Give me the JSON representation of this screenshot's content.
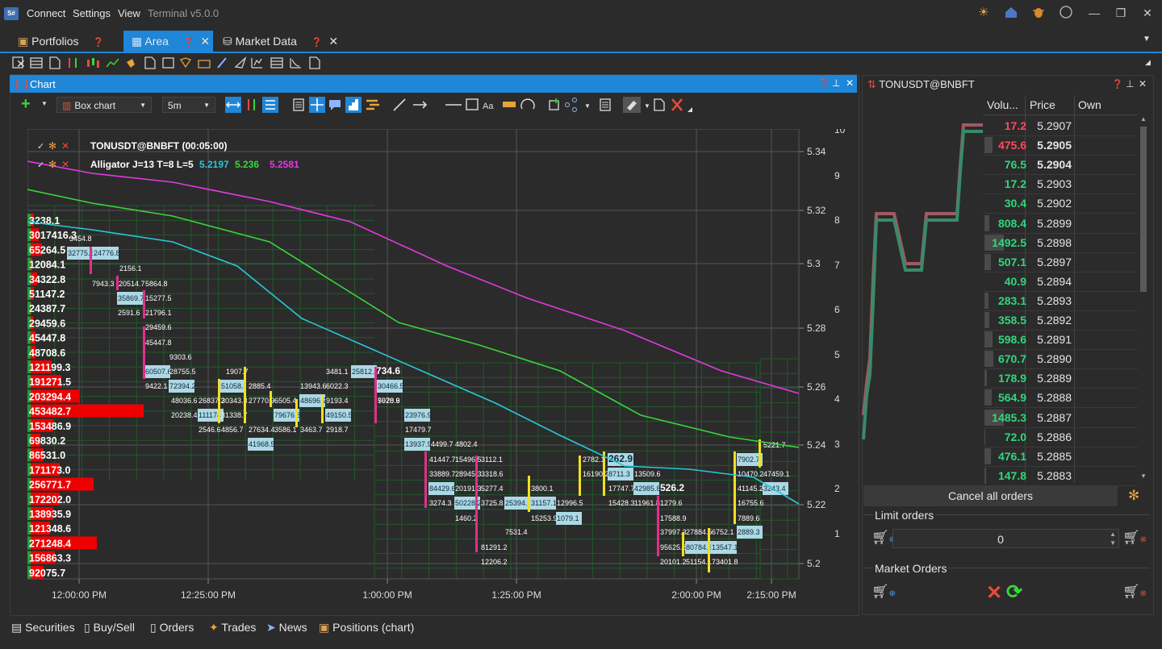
{
  "app": {
    "logo": "S#",
    "menu": [
      "Connect",
      "Settings",
      "View"
    ],
    "title": "Terminal v5.0.0",
    "title_icons": [
      "sun-icon",
      "home-icon",
      "bug-icon",
      "chat-icon"
    ],
    "accent": "#1f86d8"
  },
  "tabs": [
    {
      "label": "Portfolios",
      "active": false
    },
    {
      "label": "Area",
      "active": true
    },
    {
      "label": "Market Data",
      "active": false
    }
  ],
  "chart_panel": {
    "title": "Chart",
    "chart_type": "Box chart",
    "timeframe": "5m"
  },
  "chart_data": {
    "type": "box",
    "legend": [
      {
        "text": "TONUSDT@BNBFT (00:05:00)"
      },
      {
        "text": "Alligator J=13 T=8 L=5",
        "values": [
          "5.2197",
          "5.236",
          "5.2581"
        ],
        "colors": [
          "#29c8d8",
          "#3ad63a",
          "#e23ae2"
        ]
      }
    ],
    "x_ticks": [
      "12:00:00 PM",
      "12:25:00 PM",
      "1:00:00 PM",
      "1:25:00 PM",
      "2:00:00 PM",
      "2:15:00 PM"
    ],
    "y_ticks": [
      "5.34",
      "5.32",
      "5.3",
      "5.28",
      "5.26",
      "5.24",
      "5.22",
      "5.2"
    ],
    "y2_ticks": [
      "10",
      "9",
      "8",
      "7",
      "6",
      "5",
      "4",
      "3",
      "2",
      "1"
    ],
    "ylim": [
      5.195,
      5.345
    ],
    "series": [
      {
        "name": "Alligator Jaw",
        "color": "#e23ae2"
      },
      {
        "name": "Alligator Teeth",
        "color": "#3ad63a"
      },
      {
        "name": "Alligator Lips",
        "color": "#29c8d8"
      }
    ],
    "volume_profile": [
      "3238.1",
      "3017416.3",
      "65264.5",
      "12084.1",
      "34322.8",
      "51147.2",
      "24387.7",
      "29459.6",
      "45447.8",
      "48708.6",
      "121199.3",
      "191271.5",
      "203294.4",
      "453482.7",
      "153486.9",
      "69830.2",
      "86531.0",
      "171173.0",
      "256771.7",
      "172202.0",
      "138935.9",
      "121348.6",
      "271248.4",
      "156863.3",
      "92075.7"
    ],
    "box_labels": [
      "3454.8",
      "32775.5",
      "24776.8",
      "2156.1",
      "7943.3",
      "20514.7",
      "5864.8",
      "35869.7",
      "15277.5",
      "2591.6",
      "21796.1",
      "29459.6",
      "45447.8",
      "9303.6",
      "60507.6",
      "28755.5",
      "9422.1",
      "72394.2",
      "48036.6",
      "20238.4",
      "1907.7",
      "51058.6",
      "26837.2",
      "30343.8",
      "111174",
      "31338.7",
      "2546.6",
      "4856.7",
      "2885.4",
      "27770.9",
      "6505.4",
      "79676.8",
      "27634.4",
      "3586.1",
      "41968.5",
      "13943.6",
      "48696.2",
      "3463.7",
      "3481.1",
      "6022.3",
      "9193.4",
      "49150.5",
      "2918.7",
      "25812.8",
      "734.6",
      "30466.5",
      "5078.6",
      "7920.9",
      "23976.9",
      "17479.7",
      "13937.9",
      "4499.7",
      "4802.4",
      "41447.7",
      "15496.5",
      "3112.1",
      "33889.7",
      "28945.3",
      "3318.6",
      "84429.6",
      "20191.3",
      "5277.4",
      "3274.3",
      "50228.2",
      "3725.8",
      "1460.2",
      "81291.2",
      "12206.2",
      "25394.8",
      "7531.4",
      "3800.1",
      "31157.1",
      "15253.9",
      "12996.5",
      "1079.1",
      "2782.1",
      "262.9",
      "16190.2",
      "8711.3",
      "13509.6",
      "17747.7",
      "42985.8",
      "15428.3",
      "11961.8",
      "526.2",
      "1279.6",
      "17588.9",
      "37997.3",
      "95625.8",
      "20101.2",
      "27884.5",
      "80784.3",
      "51154.1",
      "6752.1",
      "13547.1",
      "73401.8",
      "7902.7",
      "10470.2",
      "41145.2",
      "16755.6",
      "7889.6",
      "2889.3",
      "5221.7",
      "47459.1",
      "3243.4"
    ]
  },
  "orderbook": {
    "title": "TONUSDT@BNBFT",
    "headers": [
      "Volu...",
      "Price",
      "Own"
    ],
    "rows": [
      {
        "vol": "17.2",
        "price": "5.2907",
        "side": "ask"
      },
      {
        "vol": "475.6",
        "price": "5.2905",
        "side": "ask"
      },
      {
        "vol": "76.5",
        "price": "5.2904",
        "side": "bid"
      },
      {
        "vol": "17.2",
        "price": "5.2903",
        "side": "bid"
      },
      {
        "vol": "30.4",
        "price": "5.2902",
        "side": "bid"
      },
      {
        "vol": "808.4",
        "price": "5.2899",
        "side": "bid"
      },
      {
        "vol": "1492.5",
        "price": "5.2898",
        "side": "bid"
      },
      {
        "vol": "507.1",
        "price": "5.2897",
        "side": "bid"
      },
      {
        "vol": "40.9",
        "price": "5.2894",
        "side": "bid"
      },
      {
        "vol": "283.1",
        "price": "5.2893",
        "side": "bid"
      },
      {
        "vol": "358.5",
        "price": "5.2892",
        "side": "bid"
      },
      {
        "vol": "598.6",
        "price": "5.2891",
        "side": "bid"
      },
      {
        "vol": "670.7",
        "price": "5.2890",
        "side": "bid"
      },
      {
        "vol": "178.9",
        "price": "5.2889",
        "side": "bid"
      },
      {
        "vol": "564.9",
        "price": "5.2888",
        "side": "bid"
      },
      {
        "vol": "1485.3",
        "price": "5.2887",
        "side": "bid"
      },
      {
        "vol": "72.0",
        "price": "5.2886",
        "side": "bid"
      },
      {
        "vol": "476.1",
        "price": "5.2885",
        "side": "bid"
      },
      {
        "vol": "147.8",
        "price": "5.2883",
        "side": "bid"
      }
    ],
    "cancel_all": "Cancel all orders",
    "limit_orders": "Limit orders",
    "limit_value": "0",
    "market_orders": "Market Orders"
  },
  "bottom_tabs": [
    "Securities",
    "Buy/Sell",
    "Orders",
    "Trades",
    "News",
    "Positions (chart)"
  ]
}
